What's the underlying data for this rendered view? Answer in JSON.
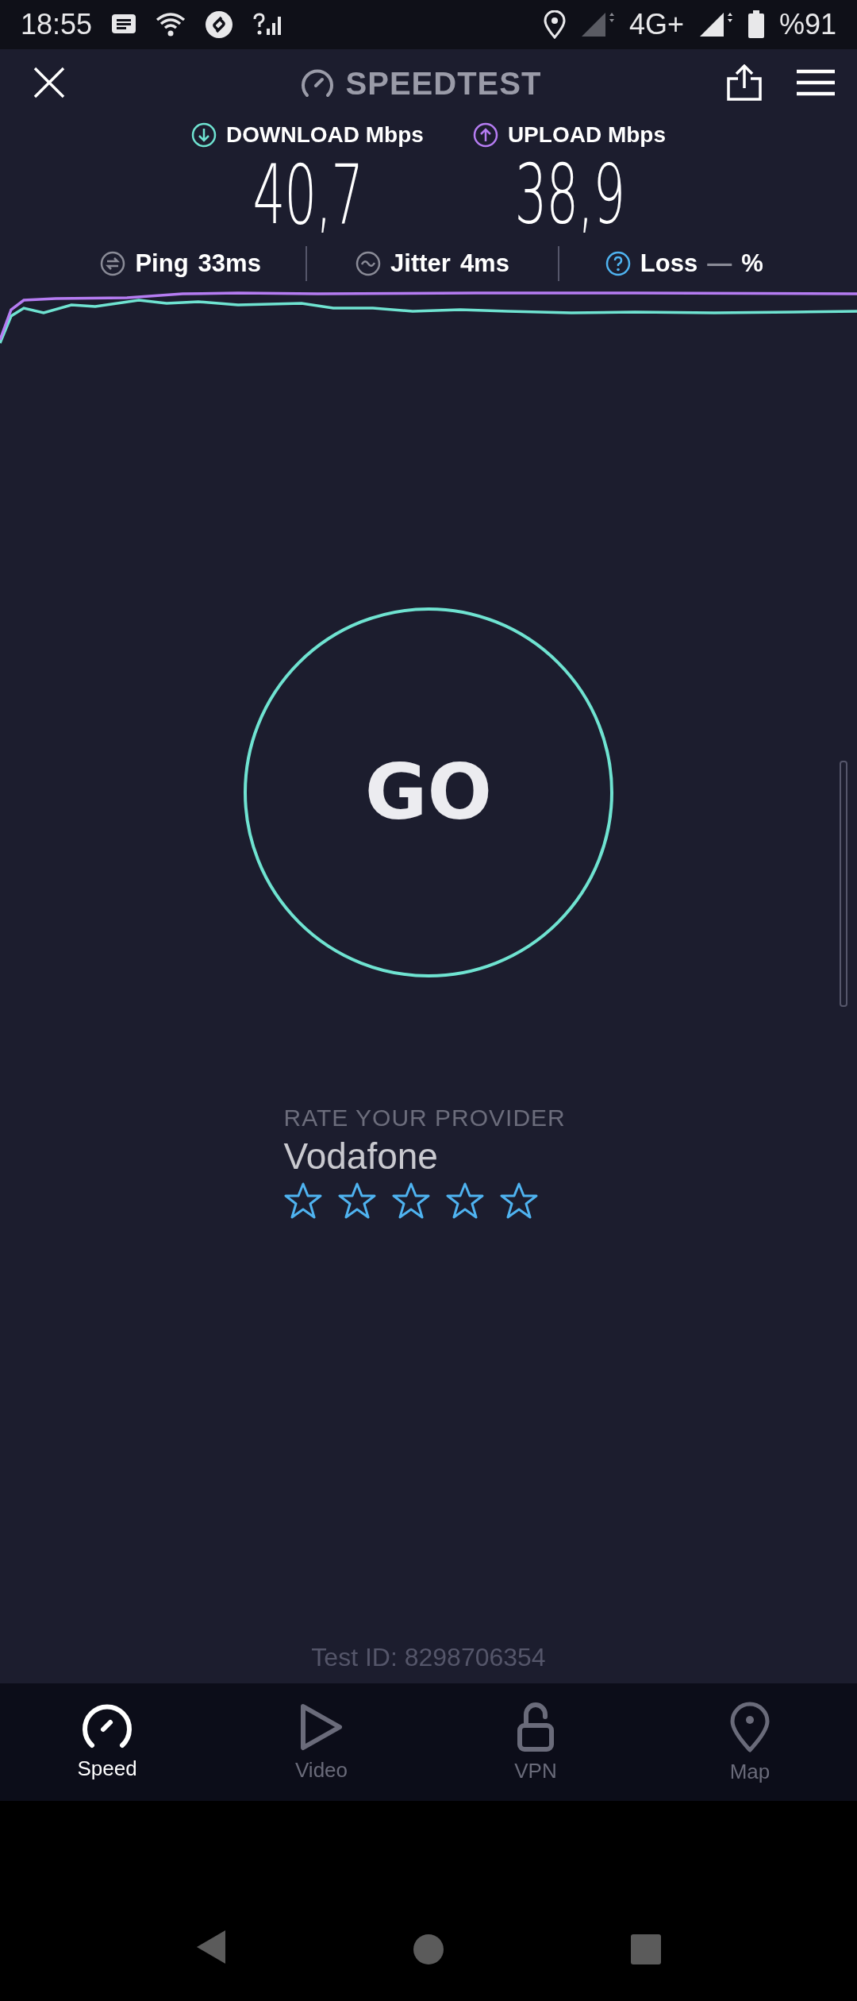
{
  "status_bar": {
    "time": "18:55",
    "network": "4G+",
    "battery": "%91"
  },
  "header": {
    "title": "SPEEDTEST"
  },
  "results": [
    {
      "kind": "download",
      "label": "DOWNLOAD Mbps",
      "value": "40,7",
      "color": "#6fe3d1"
    },
    {
      "kind": "upload",
      "label": "UPLOAD Mbps",
      "value": "38,9",
      "color": "#b57cf2"
    }
  ],
  "metrics": [
    {
      "kind": "ping",
      "label": "Ping",
      "value": "33ms"
    },
    {
      "kind": "jitter",
      "label": "Jitter",
      "value": "4ms"
    },
    {
      "kind": "loss",
      "label": "Loss",
      "value": "—",
      "unit": "%"
    }
  ],
  "go_button": {
    "label": "GO"
  },
  "rating": {
    "heading": "RATE YOUR PROVIDER",
    "provider": "Vodafone",
    "stars": 0
  },
  "test_id": "Test ID: 8298706354",
  "nav": [
    {
      "kind": "speed",
      "label": "Speed",
      "selected": true
    },
    {
      "kind": "video",
      "label": "Video",
      "selected": false
    },
    {
      "kind": "vpn",
      "label": "VPN",
      "selected": false
    },
    {
      "kind": "map",
      "label": "Map",
      "selected": false
    }
  ]
}
